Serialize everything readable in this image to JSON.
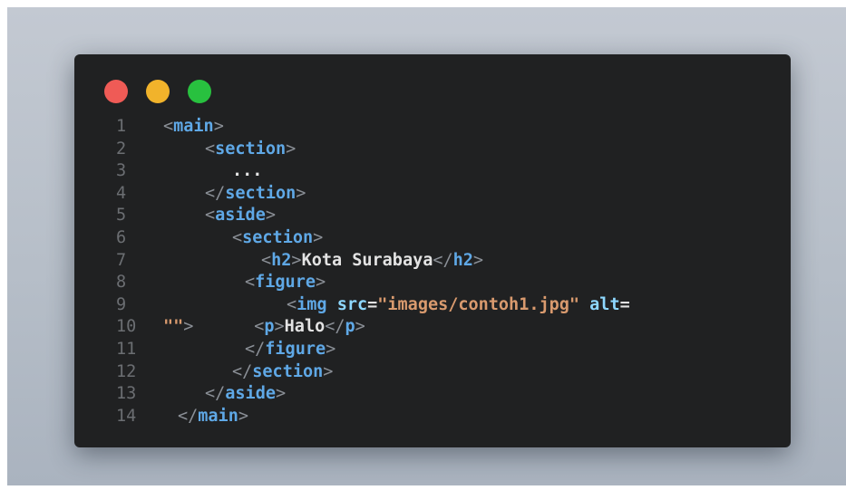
{
  "window_controls": {
    "close_color": "#ef5b56",
    "minimize_color": "#f1b32b",
    "maximize_color": "#28c13f"
  },
  "colors": {
    "tag": "#5fa8e6",
    "punctuation": "#8a8f96",
    "attribute": "#8ed8ff",
    "string": "#d99a6e",
    "text": "#e3e3e3",
    "line_number": "#6b6e72",
    "editor_background": "#202122"
  },
  "code": {
    "lines": [
      {
        "number": "1",
        "tokens": [
          {
            "t": "punct",
            "v": "<"
          },
          {
            "t": "tag",
            "v": "main"
          },
          {
            "t": "punct",
            "v": ">"
          }
        ]
      },
      {
        "number": "2",
        "tokens": [
          {
            "t": "punct",
            "v": "<"
          },
          {
            "t": "tag",
            "v": "section"
          },
          {
            "t": "punct",
            "v": ">"
          }
        ]
      },
      {
        "number": "3",
        "tokens": [
          {
            "t": "txt",
            "v": "..."
          }
        ]
      },
      {
        "number": "4",
        "tokens": [
          {
            "t": "punct",
            "v": "</"
          },
          {
            "t": "tag",
            "v": "section"
          },
          {
            "t": "punct",
            "v": ">"
          }
        ]
      },
      {
        "number": "5",
        "tokens": [
          {
            "t": "punct",
            "v": "<"
          },
          {
            "t": "tag",
            "v": "aside"
          },
          {
            "t": "punct",
            "v": ">"
          }
        ]
      },
      {
        "number": "6",
        "tokens": [
          {
            "t": "punct",
            "v": "<"
          },
          {
            "t": "tag",
            "v": "section"
          },
          {
            "t": "punct",
            "v": ">"
          }
        ]
      },
      {
        "number": "7",
        "tokens": [
          {
            "t": "punct",
            "v": "<"
          },
          {
            "t": "tag",
            "v": "h2"
          },
          {
            "t": "punct",
            "v": ">"
          },
          {
            "t": "txt",
            "v": "Kota Surabaya"
          },
          {
            "t": "punct",
            "v": "</"
          },
          {
            "t": "tag",
            "v": "h2"
          },
          {
            "t": "punct",
            "v": ">"
          }
        ]
      },
      {
        "number": "8",
        "tokens": [
          {
            "t": "punct",
            "v": "<"
          },
          {
            "t": "tag",
            "v": "figure"
          },
          {
            "t": "punct",
            "v": ">"
          }
        ]
      },
      {
        "number": "9",
        "tokens": [
          {
            "t": "punct",
            "v": "<"
          },
          {
            "t": "tag",
            "v": "img"
          },
          {
            "t": "txt",
            "v": " "
          },
          {
            "t": "attr",
            "v": "src"
          },
          {
            "t": "txt",
            "v": "="
          },
          {
            "t": "str",
            "v": "\"images/contoh1.jpg\""
          },
          {
            "t": "txt",
            "v": " "
          },
          {
            "t": "attr",
            "v": "alt"
          },
          {
            "t": "txt",
            "v": "="
          }
        ]
      },
      {
        "number": "10",
        "tokens": [
          {
            "t": "str",
            "v": "\"\""
          },
          {
            "t": "punct",
            "v": ">"
          },
          {
            "t": "txt",
            "v": "      "
          },
          {
            "t": "punct",
            "v": "<"
          },
          {
            "t": "tag",
            "v": "p"
          },
          {
            "t": "punct",
            "v": ">"
          },
          {
            "t": "txt",
            "v": "Halo"
          },
          {
            "t": "punct",
            "v": "</"
          },
          {
            "t": "tag",
            "v": "p"
          },
          {
            "t": "punct",
            "v": ">"
          }
        ]
      },
      {
        "number": "11",
        "tokens": [
          {
            "t": "punct",
            "v": "</"
          },
          {
            "t": "tag",
            "v": "figure"
          },
          {
            "t": "punct",
            "v": ">"
          }
        ]
      },
      {
        "number": "12",
        "tokens": [
          {
            "t": "punct",
            "v": "</"
          },
          {
            "t": "tag",
            "v": "section"
          },
          {
            "t": "punct",
            "v": ">"
          }
        ]
      },
      {
        "number": "13",
        "tokens": [
          {
            "t": "punct",
            "v": "</"
          },
          {
            "t": "tag",
            "v": "aside"
          },
          {
            "t": "punct",
            "v": ">"
          }
        ]
      },
      {
        "number": "14",
        "tokens": [
          {
            "t": "punct",
            "v": "</"
          },
          {
            "t": "tag",
            "v": "main"
          },
          {
            "t": "punct",
            "v": ">"
          }
        ]
      }
    ]
  }
}
